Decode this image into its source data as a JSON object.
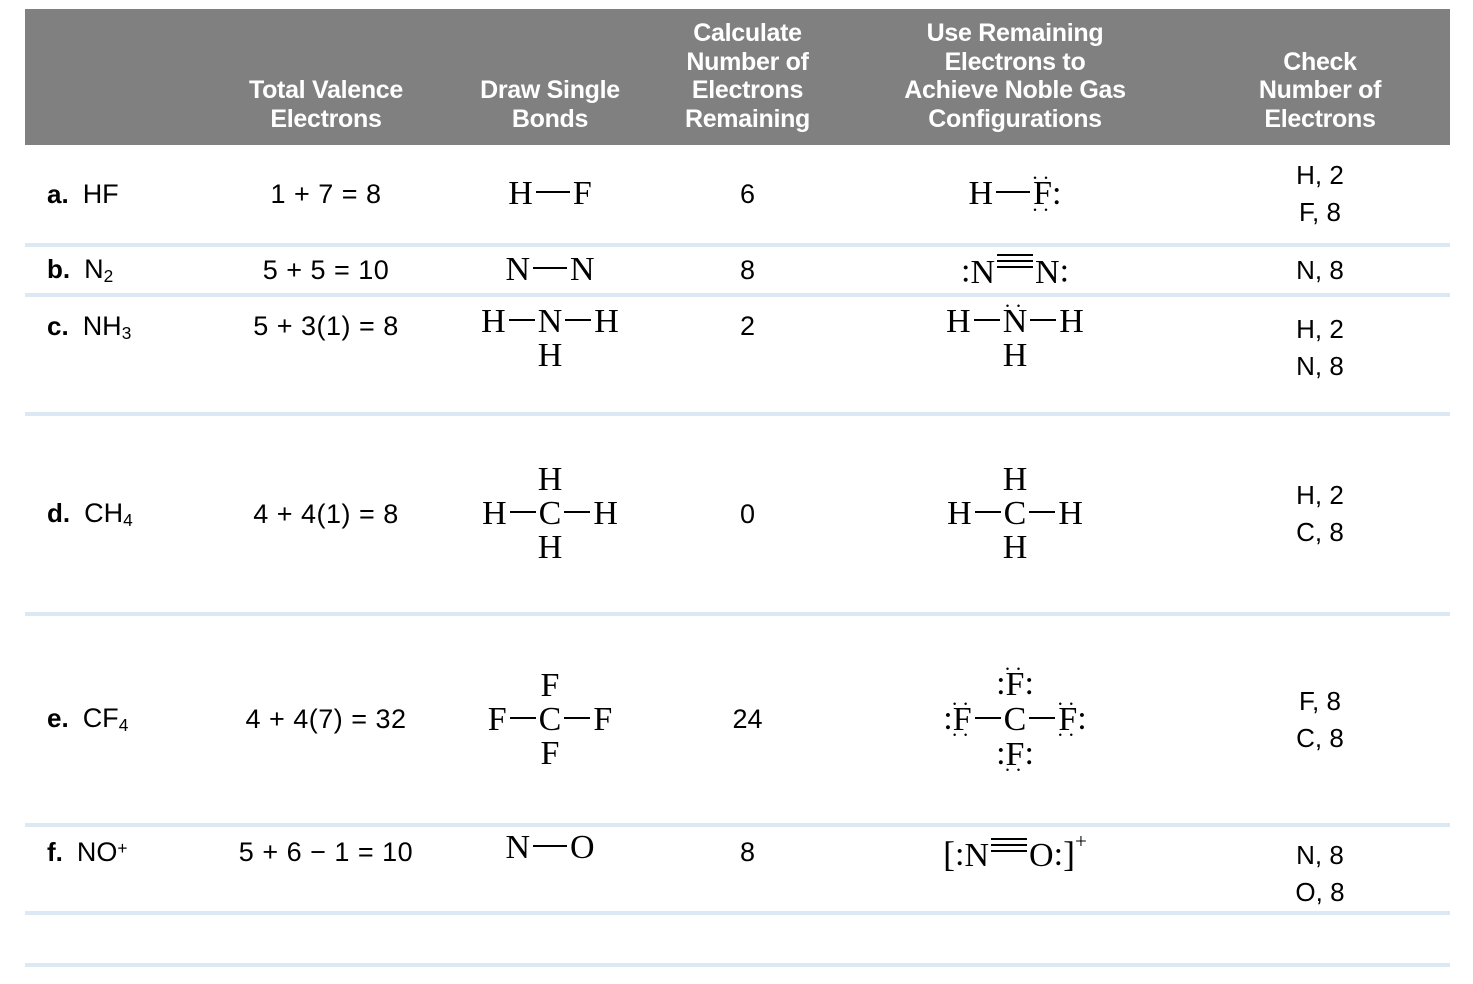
{
  "table": {
    "title_bar_color": "#808080",
    "separator_color": "#dce9f5",
    "headers": {
      "label": "",
      "valence": "Total Valence\nElectrons",
      "valence_line1": "Total Valence",
      "valence_line2": "Electrons",
      "single_line1": "Draw Single",
      "single_line2": "Bonds",
      "remaining_line1": "Calculate",
      "remaining_line2": "Number of",
      "remaining_line3": "Electrons",
      "remaining_line4": "Remaining",
      "noble_line1": "Use Remaining",
      "noble_line2": "Electrons to",
      "noble_line3": "Achieve Noble Gas",
      "noble_line4": "Configurations",
      "check_line1": "Check",
      "check_line2": "Number of",
      "check_line3": "Electrons"
    },
    "rows": [
      {
        "letter": "a.",
        "formula_main": "HF",
        "formula_sub": "",
        "formula_sup": "",
        "valence": "1 + 7 = 8",
        "single_bond": "H—F",
        "remaining": "6",
        "lewis": "H—F: (with 3 lone pairs on F)",
        "check_1": "H, 2",
        "check_2": "F, 8"
      },
      {
        "letter": "b.",
        "formula_main": "N",
        "formula_sub": "2",
        "formula_sup": "",
        "valence": "5 + 5 = 10",
        "single_bond": "N—N",
        "remaining": "8",
        "lewis": ":N≡N:",
        "check_1": "N, 8",
        "check_2": ""
      },
      {
        "letter": "c.",
        "formula_main": "NH",
        "formula_sub": "3",
        "formula_sup": "",
        "valence": "5 + 3(1) = 8",
        "single_bond": "H—N(—H)—H",
        "remaining": "2",
        "lewis": "H—N(¨)(—H)—H",
        "check_1": "H, 2",
        "check_2": "N, 8"
      },
      {
        "letter": "d.",
        "formula_main": "CH",
        "formula_sub": "4",
        "formula_sup": "",
        "valence": "4 + 4(1) = 8",
        "single_bond": "H—C(—H)(—H)—H",
        "remaining": "0",
        "lewis": "H—C(—H)(—H)—H",
        "check_1": "H, 2",
        "check_2": "C, 8"
      },
      {
        "letter": "e.",
        "formula_main": "CF",
        "formula_sub": "4",
        "formula_sup": "",
        "valence": "4 + 4(7) = 32",
        "single_bond": "F—C(—F)(—F)—F",
        "remaining": "24",
        "lewis": ":F—C(—F)(—F)—F: with lone pairs",
        "check_1": "F, 8",
        "check_2": "C, 8"
      },
      {
        "letter": "f.",
        "formula_main": "NO",
        "formula_sub": "",
        "formula_sup": "+",
        "valence": "5 + 6 − 1 = 10",
        "single_bond": "N—O",
        "remaining": "8",
        "lewis": "[:N≡O:]⁺",
        "check_1": "N, 8",
        "check_2": "O, 8"
      }
    ],
    "atoms": {
      "H": "H",
      "F": "F",
      "N": "N",
      "C": "C",
      "O": "O",
      "colon": ":",
      "two_dots": "··",
      "bracket_open": "[",
      "bracket_close": "]",
      "plus": "+"
    }
  }
}
